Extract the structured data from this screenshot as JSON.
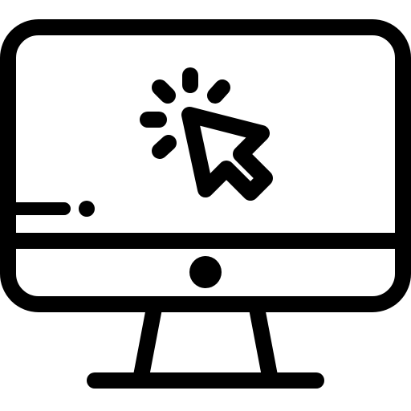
{
  "icon": {
    "name": "computer-click-icon",
    "parts": [
      "monitor-icon",
      "stand-icon",
      "power-button-icon",
      "cursor-pointer-icon",
      "click-burst-icon",
      "loading-bar-icon"
    ]
  },
  "colors": {
    "ink": "#000000",
    "background": "#ffffff"
  }
}
